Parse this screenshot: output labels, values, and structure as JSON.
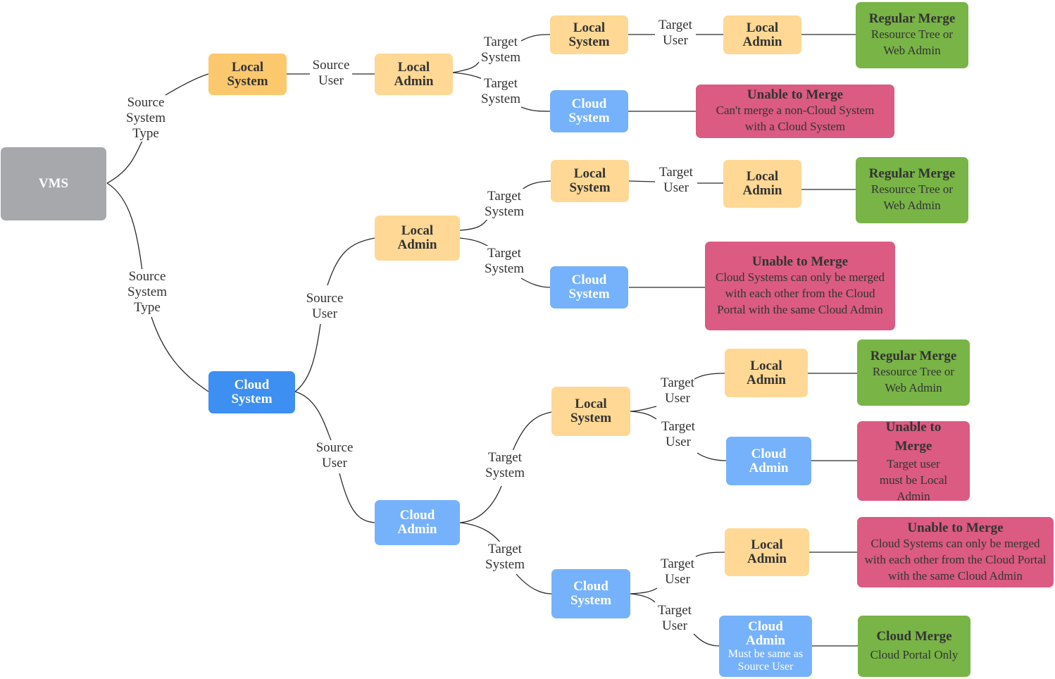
{
  "colors": {
    "root": "#a7a8ac",
    "local": "#fed894",
    "local_strong": "#fcc86e",
    "cloud": "#76b2fb",
    "cloud_strong": "#3d8ff1",
    "merge_ok": "#78b446",
    "merge_fail": "#db5b82",
    "edge": "#2b2b2b"
  },
  "nodes": {
    "vms": {
      "title": "VMS"
    },
    "src_local_system": {
      "title": "Local System"
    },
    "src_cloud_system": {
      "title": "Cloud System"
    },
    "a_local_admin": {
      "title": "Local Admin"
    },
    "a_local_system": {
      "title": "Local System"
    },
    "a_cloud_system": {
      "title": "Cloud System"
    },
    "a_local_admin_t": {
      "title": "Local Admin"
    },
    "a_result_ok": {
      "title": "Regular Merge",
      "subtitle": "Resource Tree or Web Admin"
    },
    "a_result_fail": {
      "title": "Unable to Merge",
      "subtitle": "Can't merge a non-Cloud System with a Cloud System"
    },
    "b_local_admin": {
      "title": "Local Admin"
    },
    "b_local_system": {
      "title": "Local System"
    },
    "b_cloud_system": {
      "title": "Cloud System"
    },
    "b_local_admin_t": {
      "title": "Local Admin"
    },
    "b_result_ok": {
      "title": "Regular Merge",
      "subtitle": "Resource Tree or Web Admin"
    },
    "b_result_fail": {
      "title": "Unable to Merge",
      "subtitle": "Cloud Systems can only be merged with each other from the Cloud Portal with the same Cloud Admin"
    },
    "c_cloud_admin": {
      "title": "Cloud Admin"
    },
    "c_local_system": {
      "title": "Local System"
    },
    "c_local_admin_t": {
      "title": "Local Admin"
    },
    "c_cloud_admin_t": {
      "title": "Cloud Admin"
    },
    "c_result_ok": {
      "title": "Regular Merge",
      "subtitle": "Resource Tree or Web Admin"
    },
    "c_result_fail": {
      "title": "Unable to Merge",
      "subtitle": "Target user must be Local Admin"
    },
    "c_cloud_system": {
      "title": "Cloud System"
    },
    "c_local_admin_t2": {
      "title": "Local Admin"
    },
    "c_cloud_admin_t2": {
      "title": "Cloud Admin",
      "subtitle": "Must be same as Source User"
    },
    "c_result_fail2": {
      "title": "Unable to Merge",
      "subtitle": "Cloud Systems can only be merged with each other from the Cloud Portal with the same Cloud Admin"
    },
    "c_result_cloud": {
      "title": "Cloud Merge",
      "subtitle": "Cloud Portal Only"
    }
  },
  "edge_labels": {
    "source_system_type": "Source\nSystem\nType",
    "source_user": "Source\nUser",
    "target_system": "Target\nSystem",
    "target_user": "Target\nUser"
  }
}
